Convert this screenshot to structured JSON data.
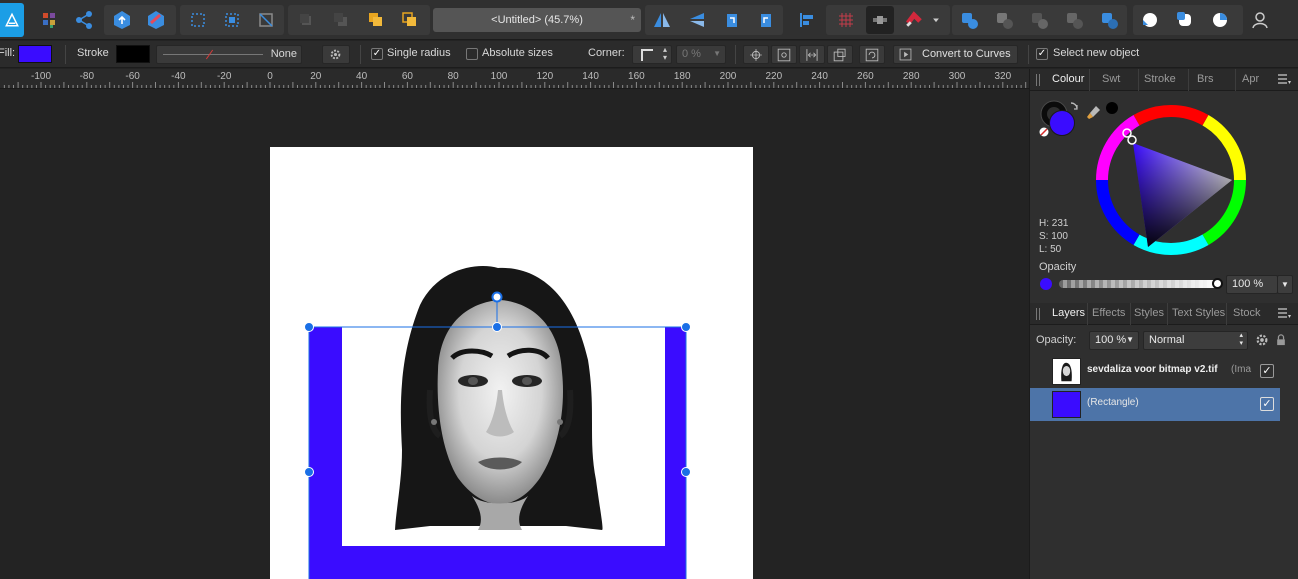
{
  "app": {
    "document_title": "<Untitled> (45.7%)",
    "modified_mark": "*"
  },
  "toolbar": {
    "icons": [
      "affinity-photo-logo",
      "persona-grid-icon",
      "share-icon",
      "upload-icon",
      "develop-icon",
      "marquee-select-icon",
      "select-all-icon",
      "transform-select-icon",
      "arrange-back-icon",
      "arrange-backward-icon",
      "arrange-forward-icon",
      "arrange-front-icon",
      "flip-horizontal-icon",
      "flip-vertical-icon",
      "rotate-left-icon",
      "rotate-right-icon",
      "align-left-icon",
      "grid-icon",
      "snapping-toggle-icon",
      "magnet-icon",
      "add-operation-icon",
      "subtract-operation-icon",
      "intersect-operation-icon",
      "xor-operation-icon",
      "divide-operation-icon",
      "assistant-icon",
      "quick-mask-icon",
      "colour-picker-icon",
      "user-icon"
    ]
  },
  "context": {
    "fill_label": "Fill:",
    "fill_color": "#3a0cff",
    "stroke_label": "Stroke",
    "stroke_color": "#000000",
    "stroke_width_text": "None",
    "single_radius_label": "Single radius",
    "single_radius_checked": true,
    "absolute_sizes_label": "Absolute sizes",
    "absolute_sizes_checked": false,
    "corner_label": "Corner:",
    "corner_value": "0 %",
    "convert_label": "Convert to Curves",
    "select_new_label": "Select new object",
    "select_new_checked": true
  },
  "ruler": {
    "labels": [
      "-100",
      "-80",
      "-60",
      "-40",
      "-20",
      "0",
      "20",
      "40",
      "60",
      "80",
      "100",
      "120",
      "140",
      "160",
      "180",
      "200",
      "220",
      "240",
      "260",
      "280",
      "300",
      "320"
    ]
  },
  "colour_panel": {
    "tabs": [
      "Colour",
      "Swt",
      "Stroke",
      "Brs",
      "Apr"
    ],
    "active_tab": "Colour",
    "h": "H: 231",
    "s": "S: 100",
    "l": "L: 50",
    "opacity_label": "Opacity",
    "opacity_value": "100 %",
    "current_color": "#3a0cff"
  },
  "layers_panel": {
    "tabs": [
      "Layers",
      "Effects",
      "Styles",
      "Text Styles",
      "Stock"
    ],
    "active_tab": "Layers",
    "opacity_label": "Opacity:",
    "opacity_value": "100 %",
    "blend_mode": "Normal",
    "layers": [
      {
        "name": "sevdaliza voor bitmap v2.tif",
        "type": "(Ima",
        "visible": true,
        "selected": false
      },
      {
        "name": "(Rectangle)",
        "type": "",
        "visible": true,
        "selected": true
      }
    ]
  },
  "canvas": {
    "page_color": "#ffffff",
    "rectangle_color": "#3a0cff",
    "selection_color": "#1a6fe6"
  }
}
